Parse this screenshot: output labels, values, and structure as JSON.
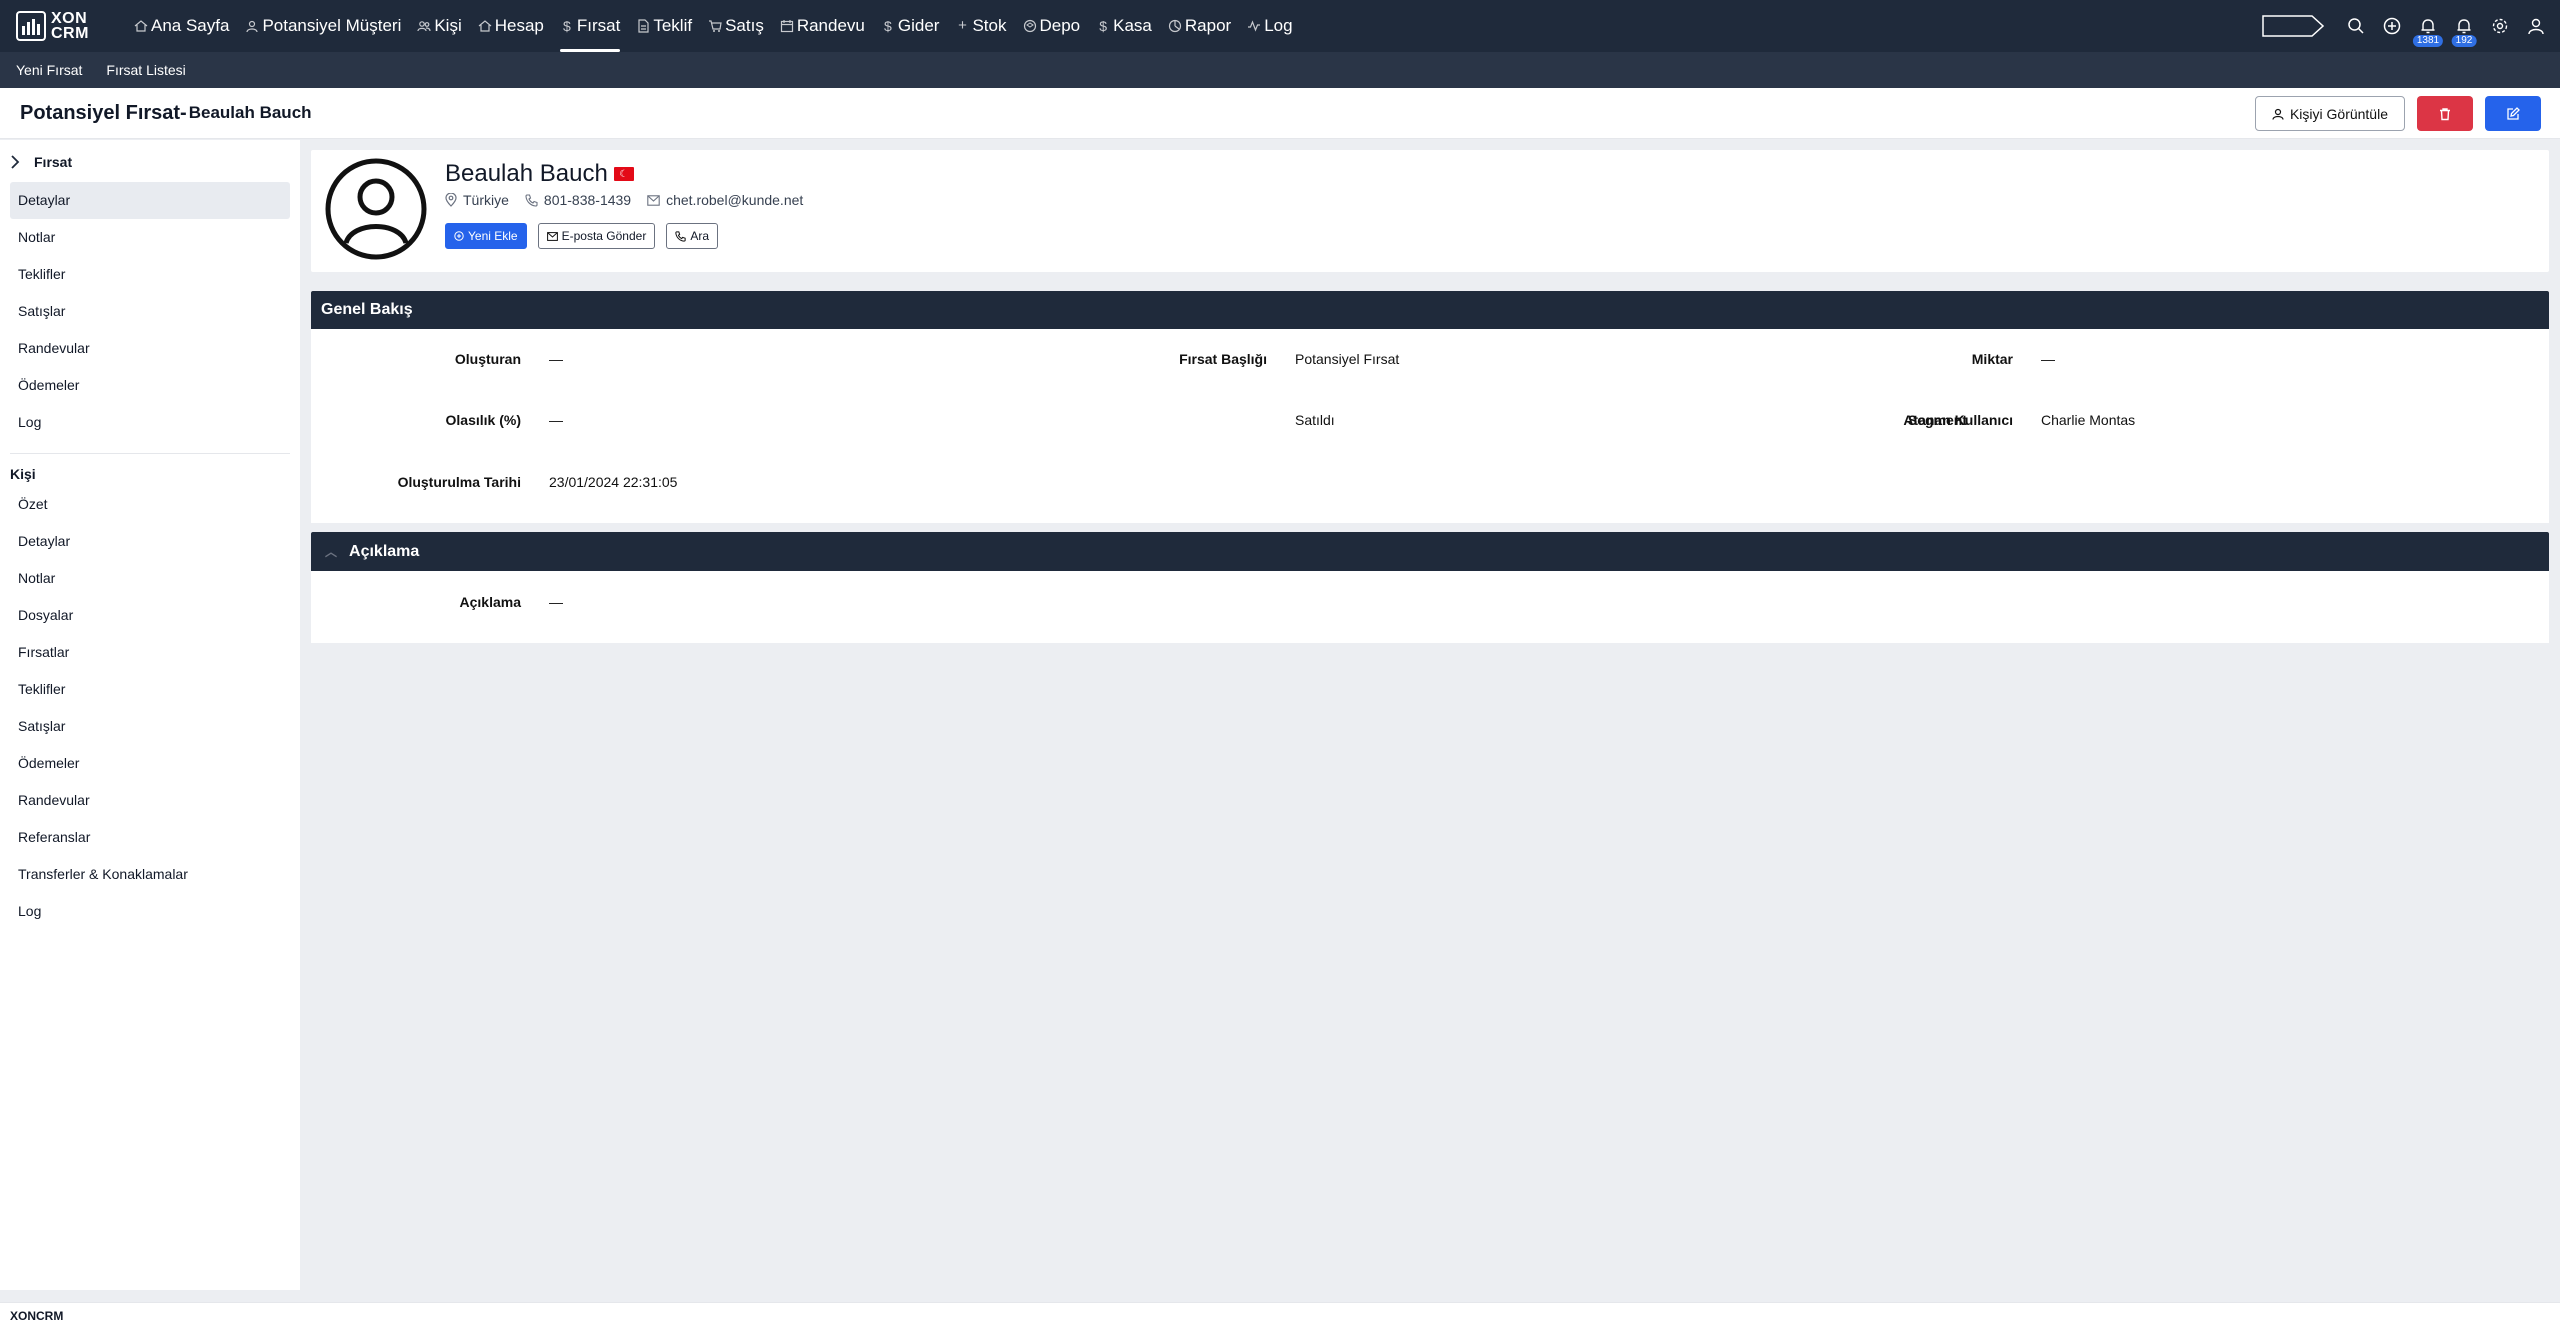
{
  "app": {
    "logo_line1": "XON",
    "logo_line2": "CRM",
    "footer_brand": "XONCRM"
  },
  "nav": {
    "items": [
      {
        "label": "Ana Sayfa",
        "icon": "home-icon"
      },
      {
        "label": "Potansiyel Müşteri",
        "icon": "user-icon"
      },
      {
        "label": "Kişi",
        "icon": "users-icon"
      },
      {
        "label": "Hesap",
        "icon": "building-icon"
      },
      {
        "label": "Fırsat",
        "icon": "dollar-icon",
        "active": true
      },
      {
        "label": "Teklif",
        "icon": "document-icon"
      },
      {
        "label": "Satış",
        "icon": "cart-icon"
      },
      {
        "label": "Randevu",
        "icon": "calendar-icon"
      },
      {
        "label": "Gider",
        "icon": "dollar-icon"
      },
      {
        "label": "Stok",
        "icon": "plus-icon"
      },
      {
        "label": "Depo",
        "icon": "box-icon"
      },
      {
        "label": "Kasa",
        "icon": "dollar-icon"
      },
      {
        "label": "Rapor",
        "icon": "chart-pie-icon"
      },
      {
        "label": "Log",
        "icon": "activity-icon"
      }
    ],
    "notification_count_1": "1381",
    "notification_count_2": "192"
  },
  "subnav": {
    "new_opportunity": "Yeni Fırsat",
    "opportunity_list": "Fırsat Listesi"
  },
  "header": {
    "title": "Potansiyel Fırsat-",
    "name": "Beaulah Bauch",
    "view_contact_label": "Kişiyi Görüntüle"
  },
  "sidebar": {
    "section1_title": "Fırsat",
    "section1_items": [
      "Detaylar",
      "Notlar",
      "Teklifler",
      "Satışlar",
      "Randevular",
      "Ödemeler",
      "Log"
    ],
    "section2_title": "Kişi",
    "section2_items": [
      "Özet",
      "Detaylar",
      "Notlar",
      "Dosyalar",
      "Fırsatlar",
      "Teklifler",
      "Satışlar",
      "Ödemeler",
      "Randevular",
      "Referanslar",
      "Transferler & Konaklamalar",
      "Log"
    ]
  },
  "profile": {
    "name": "Beaulah Bauch",
    "country": "Türkiye",
    "phone": "801-838-1439",
    "email": "chet.robel@kunde.net",
    "add_new_label": "Yeni Ekle",
    "send_email_label": "E-posta Gönder",
    "call_label": "Ara"
  },
  "overview": {
    "title": "Genel Bakış",
    "created_by_label": "Oluşturan",
    "created_by_value": "—",
    "opportunity_title_label": "Fırsat Başlığı",
    "opportunity_title_value": "Potansiyel Fırsat",
    "amount_label": "Miktar",
    "amount_value": "—",
    "probability_label": "Olasılık (%)",
    "probability_value": "—",
    "segment_label": "Segment",
    "segment_value": "Satıldı",
    "assigned_user_label": "Atanan Kullanıcı",
    "assigned_user_value": "Charlie Montas",
    "created_date_label": "Oluşturulma Tarihi",
    "created_date_value": "23/01/2024 22:31:05"
  },
  "description": {
    "title": "Açıklama",
    "label": "Açıklama",
    "value": "—"
  }
}
